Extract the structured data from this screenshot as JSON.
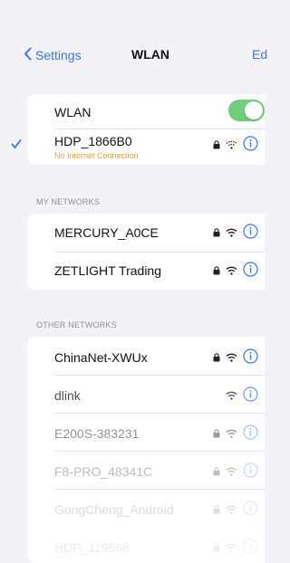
{
  "nav": {
    "back_label": "Settings",
    "title": "WLAN",
    "edit_label": "Ed"
  },
  "wifi": {
    "toggle_label": "WLAN",
    "toggle_on": true
  },
  "connected": {
    "name": "HDP_1866B0",
    "status": "No Internet Connection"
  },
  "sections": {
    "my_networks": "MY NETWORKS",
    "other_networks": "OTHER NETWORKS"
  },
  "my_networks": [
    {
      "name": "MERCURY_A0CE",
      "locked": true
    },
    {
      "name": "ZETLIGHT Trading",
      "locked": true
    }
  ],
  "other_networks": [
    {
      "name": "ChinaNet-XWUx",
      "locked": true
    },
    {
      "name": "dlink",
      "locked": false
    },
    {
      "name": "E200S-383231",
      "locked": true
    },
    {
      "name": "F8-PRO_48341C",
      "locked": true
    },
    {
      "name": "GongCheng_Android",
      "locked": true
    },
    {
      "name": "HDP_119568",
      "locked": true
    }
  ],
  "colors": {
    "accent": "#3478f6",
    "toggle": "#6fcf7b",
    "warning": "#f0a030",
    "background": "#f2f2f7"
  }
}
